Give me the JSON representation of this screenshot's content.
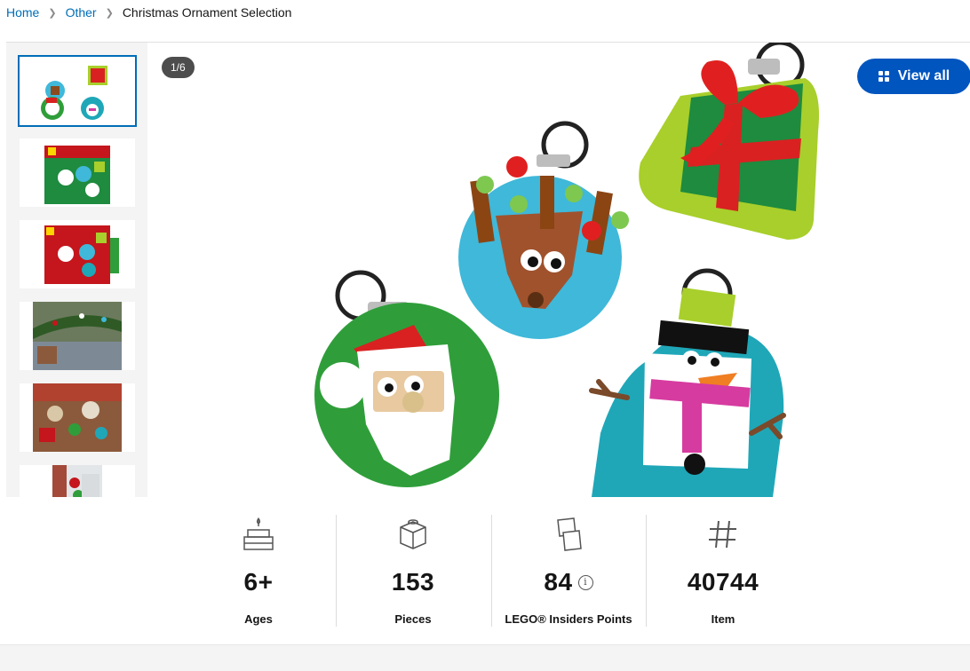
{
  "breadcrumb": {
    "home": "Home",
    "category": "Other",
    "current": "Christmas Ornament Selection"
  },
  "gallery": {
    "counter": "1/6",
    "view_all_label": "View all",
    "thumbnails": [
      {
        "name": "ornaments-set"
      },
      {
        "name": "box-front"
      },
      {
        "name": "box-back"
      },
      {
        "name": "garland-lifestyle"
      },
      {
        "name": "table-lifestyle"
      },
      {
        "name": "tree-lifestyle"
      }
    ]
  },
  "specs": {
    "ages": {
      "value": "6+",
      "label": "Ages",
      "icon": "cake-icon"
    },
    "pieces": {
      "value": "153",
      "label": "Pieces",
      "icon": "brick-icon"
    },
    "points": {
      "value": "84",
      "label": "LEGO® Insiders Points",
      "icon": "points-card-icon",
      "info": "i"
    },
    "item": {
      "value": "40744",
      "label": "Item",
      "icon": "hash-icon"
    }
  },
  "colors": {
    "link": "#006db7",
    "primary_button": "#0055bf",
    "counter_bg": "#4d4d4d"
  }
}
